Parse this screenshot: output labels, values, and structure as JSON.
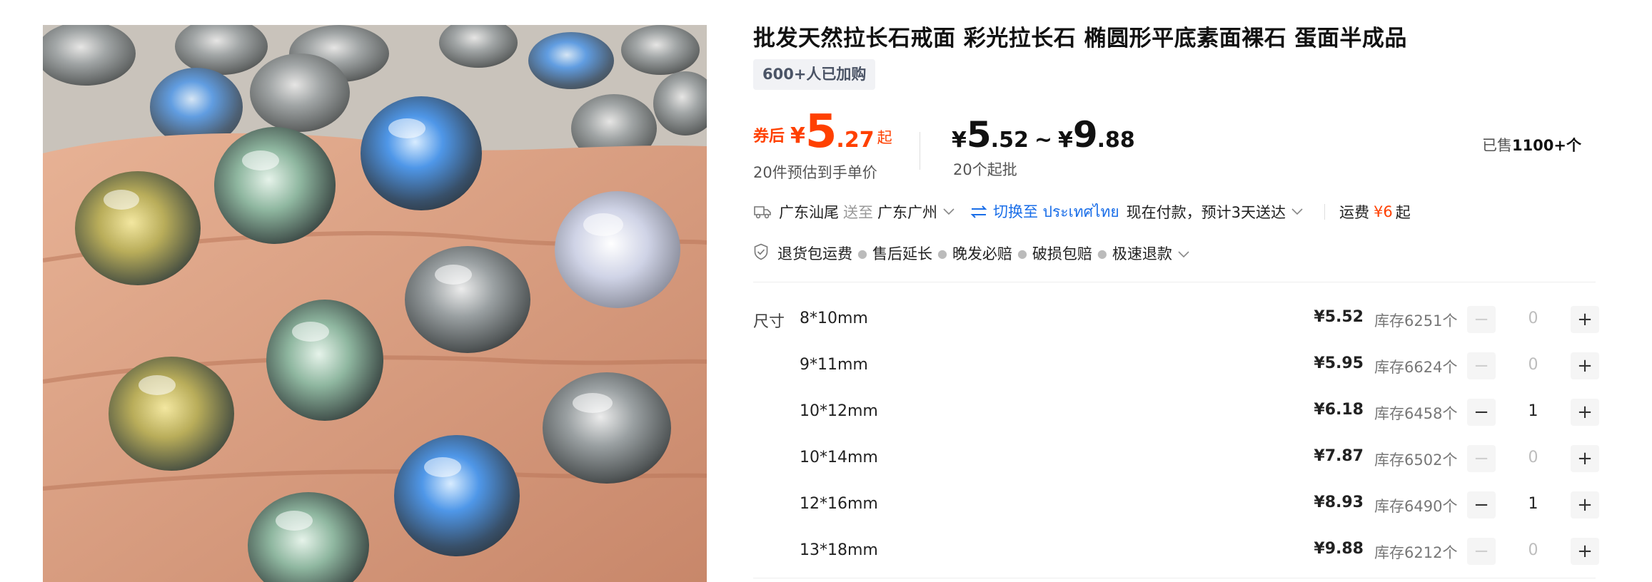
{
  "product": {
    "image_alt": "labradorite-cabochons-on-fingers",
    "title": "批发天然拉长石戒面 彩光拉长石 椭圆形平底素面裸石 蛋面半成品",
    "buyers_badge": "600+人已加购"
  },
  "pricing": {
    "coupon_tag": "券后",
    "currency": "¥",
    "coupon_price_int": "5",
    "coupon_price_dec": ".27",
    "coupon_suffix": "起",
    "coupon_note": "20件预估到手单价",
    "range_low_int": "5",
    "range_low_dec": ".52",
    "range_sep": "~",
    "range_high_int": "9",
    "range_high_dec": ".88",
    "moq_note": "20个起批",
    "sold_prefix": "已售",
    "sold_count": "1100+个"
  },
  "shipping": {
    "origin": "广东汕尾",
    "send_to_label": "送至",
    "destination": "广东广州",
    "switch_label": "切换至 ประเทศไทย",
    "delivery_note": "现在付款，预计3天送达",
    "fee_label": "运费",
    "fee_value": "¥6",
    "fee_suffix": "起"
  },
  "guarantees": [
    "退货包运费",
    "售后延长",
    "晚发必赔",
    "破损包赔",
    "极速退款"
  ],
  "specs": {
    "label": "尺寸",
    "rows": [
      {
        "size": "8*10mm",
        "price": "¥5.52",
        "stock": "库存6251个",
        "qty": "0"
      },
      {
        "size": "9*11mm",
        "price": "¥5.95",
        "stock": "库存6624个",
        "qty": "0"
      },
      {
        "size": "10*12mm",
        "price": "¥6.18",
        "stock": "库存6458个",
        "qty": "1"
      },
      {
        "size": "10*14mm",
        "price": "¥7.87",
        "stock": "库存6502个",
        "qty": "0"
      },
      {
        "size": "12*16mm",
        "price": "¥8.93",
        "stock": "库存6490个",
        "qty": "1"
      },
      {
        "size": "13*18mm",
        "price": "¥9.88",
        "stock": "库存6212个",
        "qty": "0"
      }
    ],
    "minus_symbol": "−",
    "plus_symbol": "+"
  },
  "colors": {
    "accent_red": "#ff4000",
    "link_blue": "#1a6ee8"
  }
}
